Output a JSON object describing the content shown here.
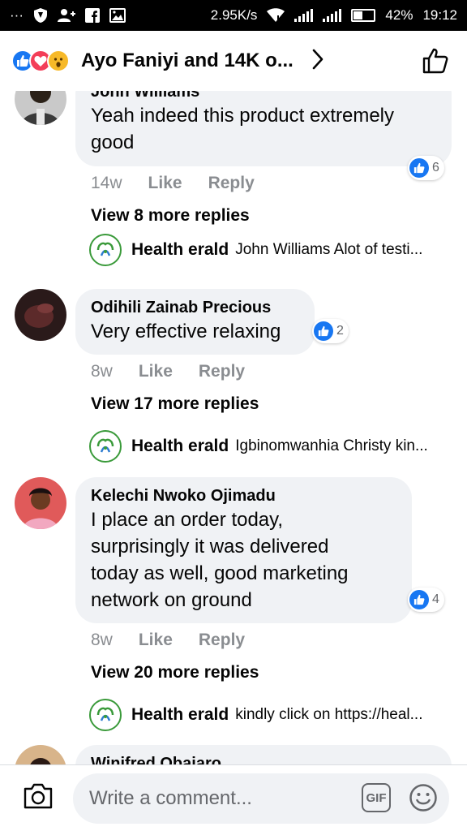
{
  "status_bar": {
    "network_speed": "2.95K/s",
    "battery": "42%",
    "battery_level": 0.42,
    "time": "19:12",
    "icons": [
      "more-icon",
      "vpn-shield-icon",
      "add-contact-icon",
      "facebook-icon",
      "gallery-icon",
      "wifi-icon",
      "signal-icon",
      "signal-icon",
      "battery-icon"
    ]
  },
  "header": {
    "reactions": [
      "like-icon",
      "love-icon",
      "wow-icon"
    ],
    "title": "Ayo Faniyi and 14K o..."
  },
  "comments": [
    {
      "author": "John Williams",
      "text_lines": [
        "Yeah indeed this product extremely",
        "good"
      ],
      "likes": "6",
      "time": "14w",
      "like_label": "Like",
      "reply_label": "Reply",
      "more_replies": "View 8 more replies",
      "reply_preview": {
        "author": "Health erald",
        "text": "John Williams Alot of testi..."
      }
    },
    {
      "author": "Odihili Zainab Precious",
      "text_lines": [
        "Very effective relaxing"
      ],
      "likes": "2",
      "time": "8w",
      "like_label": "Like",
      "reply_label": "Reply",
      "more_replies": "View 17 more replies",
      "reply_preview": {
        "author": "Health erald",
        "text": "Igbinomwanhia Christy kin..."
      }
    },
    {
      "author": "Kelechi Nwoko Ojimadu",
      "text_lines": [
        "I place an order  today,",
        "surprisingly  it was delivered",
        "today as well, good marketing",
        "network  on ground"
      ],
      "likes": "4",
      "time": "8w",
      "like_label": "Like",
      "reply_label": "Reply",
      "more_replies": "View 20 more replies",
      "reply_preview": {
        "author": "Health erald",
        "text": "kindly click on https://heal..."
      }
    },
    {
      "author": "Winifred Obajaro"
    }
  ],
  "composer": {
    "placeholder": "Write a comment...",
    "gif_label": "GIF"
  },
  "colors": {
    "accent": "#1877f2",
    "bubble": "#f0f2f5",
    "meta_text": "#8a8d91"
  }
}
